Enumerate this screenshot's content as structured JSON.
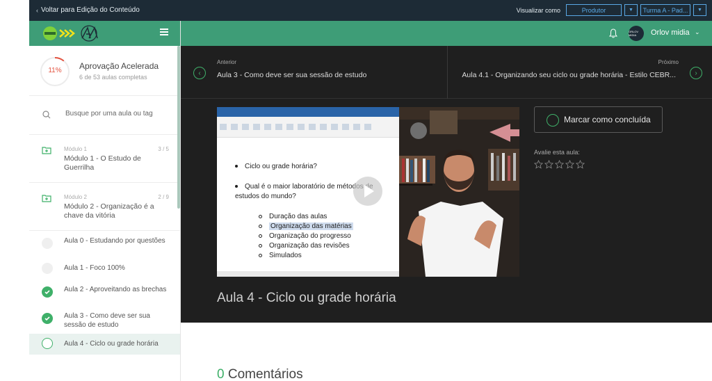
{
  "topbar": {
    "back_label": "Voltar para Edição do Conteúdo",
    "view_as_label": "Visualizar como",
    "view_as_value": "Produtor",
    "class_value": "Turma A - Pad..."
  },
  "header": {
    "user_name": "Orlov midia",
    "avatar_text": "ORLOV MIDIA"
  },
  "course": {
    "progress_percent": 11,
    "progress_label": "11%",
    "title": "Aprovação Acelerada",
    "subtitle": "6 de 53 aulas completas"
  },
  "search": {
    "placeholder": "Busque por uma aula ou tag"
  },
  "modules": [
    {
      "kicker": "Módulo 1",
      "count": "3 / 5",
      "title": "Módulo 1 - O Estudo de Guerrilha"
    },
    {
      "kicker": "Módulo 2",
      "count": "2 / 9",
      "title": "Módulo 2 - Organização é a chave da vitória"
    }
  ],
  "lessons": [
    {
      "title": "Aula 0 - Estudando por questões",
      "status": "empty"
    },
    {
      "title": "Aula 1 - Foco 100%",
      "status": "empty"
    },
    {
      "title": "Aula 2 - Aproveitando as brechas",
      "status": "done"
    },
    {
      "title": "Aula 3 - Como deve ser sua sessão de estudo",
      "status": "done"
    },
    {
      "title": "Aula 4 - Ciclo ou grade horária",
      "status": "current"
    }
  ],
  "nav": {
    "prev_kicker": "Anterior",
    "prev_title": "Aula 3 - Como deve ser sua sessão de estudo",
    "next_kicker": "Próximo",
    "next_title": "Aula 4.1 - Organizando seu ciclo ou grade horária - Estilo CEBR..."
  },
  "video": {
    "slide_bullets": [
      "Ciclo ou grade horária?",
      "Qual é o maior laboratório de métodos de estudos do mundo?"
    ],
    "slide_sub_items": [
      "Duração das aulas",
      "Organização das matérias",
      "Organização do progresso",
      "Organização das revisões",
      "Simulados"
    ]
  },
  "actions": {
    "mark_done_label": "Marcar como concluída",
    "rate_label": "Avalie esta aula:",
    "stars": 5
  },
  "lesson": {
    "title": "Aula 4 - Ciclo ou grade horária"
  },
  "comments": {
    "count": "0",
    "label": "Comentários"
  },
  "colors": {
    "brand_green": "#3e9d77",
    "done_green": "#3fb069",
    "dark_bg": "#1f1f1f",
    "topbar_bg": "#1d2b36",
    "link_blue": "#5aa9e6",
    "progress_red": "#e3523f"
  }
}
